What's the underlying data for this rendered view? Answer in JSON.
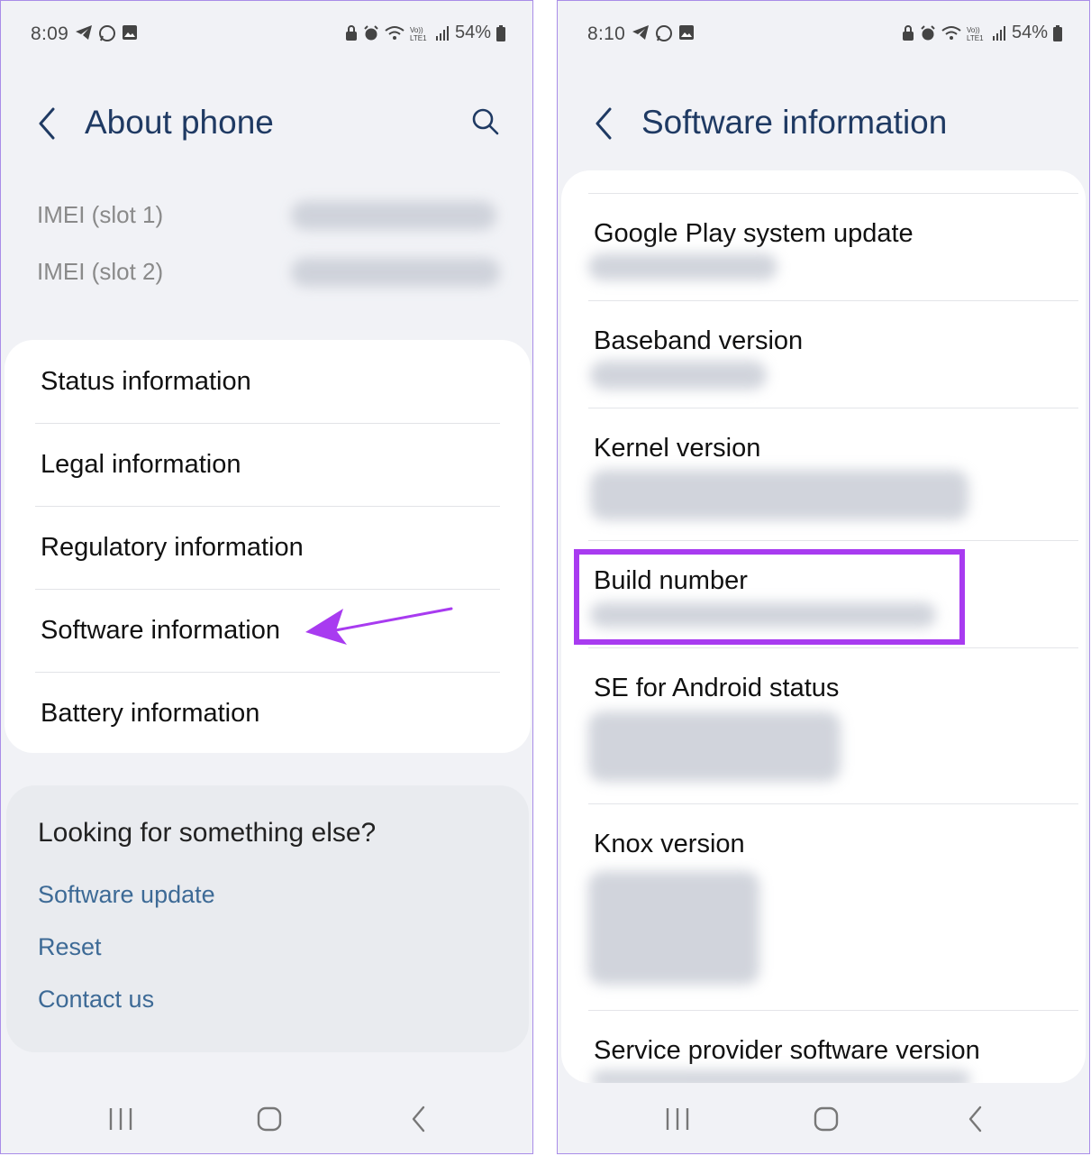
{
  "left": {
    "status": {
      "time": "8:09",
      "battery": "54%"
    },
    "header": {
      "title": "About phone"
    },
    "imei": [
      {
        "label": "IMEI (slot 1)"
      },
      {
        "label": "IMEI (slot 2)"
      }
    ],
    "menu": [
      {
        "label": "Status information"
      },
      {
        "label": "Legal information"
      },
      {
        "label": "Regulatory information"
      },
      {
        "label": "Software information"
      },
      {
        "label": "Battery information"
      }
    ],
    "looking": {
      "title": "Looking for something else?",
      "links": [
        {
          "label": "Software update"
        },
        {
          "label": "Reset"
        },
        {
          "label": "Contact us"
        }
      ]
    }
  },
  "right": {
    "status": {
      "time": "8:10",
      "battery": "54%"
    },
    "header": {
      "title": "Software information"
    },
    "items": [
      {
        "label": "Google Play system update"
      },
      {
        "label": "Baseband version"
      },
      {
        "label": "Kernel version"
      },
      {
        "label": "Build number"
      },
      {
        "label": "SE for Android status"
      },
      {
        "label": "Knox version"
      },
      {
        "label": "Service provider software version"
      }
    ]
  },
  "colors": {
    "accent": "#a83bf0",
    "title": "#1f3a63",
    "link": "#3d6a96",
    "background": "#f1f2f6"
  },
  "icons": [
    "telegram-icon",
    "whatsapp-icon",
    "gallery-icon",
    "lock-icon",
    "alarm-icon",
    "wifi-icon",
    "volte-icon",
    "signal-icon",
    "battery-icon",
    "back-icon",
    "search-icon",
    "recents-icon",
    "home-icon",
    "nav-back-icon"
  ]
}
